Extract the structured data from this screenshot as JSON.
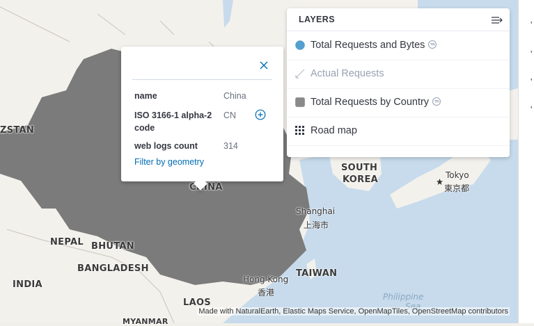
{
  "map": {
    "labels": {
      "kazakhstan": "ZSTAN",
      "china": "CHINA",
      "south_korea_1": "SOUTH",
      "south_korea_2": "KOREA",
      "tokyo": "Tokyo",
      "tokyo_cjk": "東京都",
      "shanghai": "Shanghai",
      "shanghai_cjk": "上海市",
      "nepal": "NEPAL",
      "bhutan": "BHUTAN",
      "bangladesh": "BANGLADESH",
      "india": "INDIA",
      "hong_kong": "Hong Kong",
      "hong_kong_cjk": "香港",
      "taiwan": "TAIWAN",
      "laos": "LAOS",
      "myanmar": "MYANMAR",
      "philippine_sea": "Philippine",
      "sea": "Sea"
    },
    "attribution": "Made with NaturalEarth, Elastic Maps Service, OpenMapTiles, OpenStreetMap contributors",
    "colors": {
      "land": "#f3f1ec",
      "water": "#c7dbec",
      "highlight": "#7b7b7b"
    }
  },
  "tooltip": {
    "rows": [
      {
        "key": "name",
        "value": "China"
      },
      {
        "key": "ISO 3166-1 alpha-2 code",
        "value": "CN"
      },
      {
        "key": "web logs count",
        "value": "314"
      }
    ],
    "filter_link": "Filter by geometry",
    "close_icon": "close-icon",
    "add_filter_icon": "plus-in-circle-icon"
  },
  "layers": {
    "title": "LAYERS",
    "items": [
      {
        "name": "Total Requests and Bytes",
        "swatch": "circle",
        "color": "#54a0d0"
      },
      {
        "name": "Actual Requests",
        "swatch": "line",
        "color": "#b8bec8"
      },
      {
        "name": "Total Requests by Country",
        "swatch": "square",
        "color": "#8a8a8a"
      },
      {
        "name": "Road map",
        "swatch": "grid",
        "color": "#343741"
      }
    ]
  }
}
